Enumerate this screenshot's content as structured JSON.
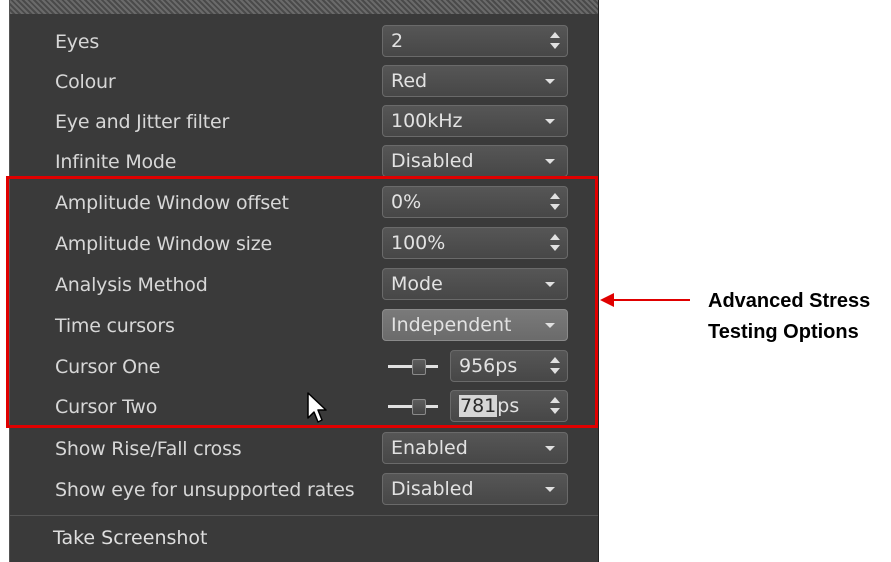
{
  "rows": [
    {
      "label": "Eyes",
      "type": "spin",
      "value": "2"
    },
    {
      "label": "Colour",
      "type": "dropdown",
      "value": "Red"
    },
    {
      "label": "Eye and Jitter filter",
      "type": "dropdown",
      "value": "100kHz"
    },
    {
      "label": "Infinite Mode",
      "type": "dropdown",
      "value": "Disabled"
    },
    {
      "label": "Amplitude Window offset",
      "type": "spin",
      "value": "0%"
    },
    {
      "label": "Amplitude Window size",
      "type": "spin",
      "value": "100%"
    },
    {
      "label": "Analysis Method",
      "type": "dropdown",
      "value": "Mode"
    },
    {
      "label": "Time cursors",
      "type": "dropdown",
      "value": "Independent"
    },
    {
      "label": "Cursor One",
      "type": "slider-spin",
      "value": "956ps"
    },
    {
      "label": "Cursor Two",
      "type": "slider-spin",
      "value_selected": "781",
      "value_unit": "ps"
    },
    {
      "label": "Show Rise/Fall cross",
      "type": "dropdown",
      "value": "Enabled"
    },
    {
      "label": "Show eye for unsupported rates",
      "type": "dropdown",
      "value": "Disabled"
    }
  ],
  "take_screenshot": "Take Screenshot",
  "callout": {
    "line1": "Advanced Stress",
    "line2": "Testing Options"
  },
  "colors": {
    "highlight_box": "#e00000",
    "panel_bg": "#3a3a3a"
  }
}
